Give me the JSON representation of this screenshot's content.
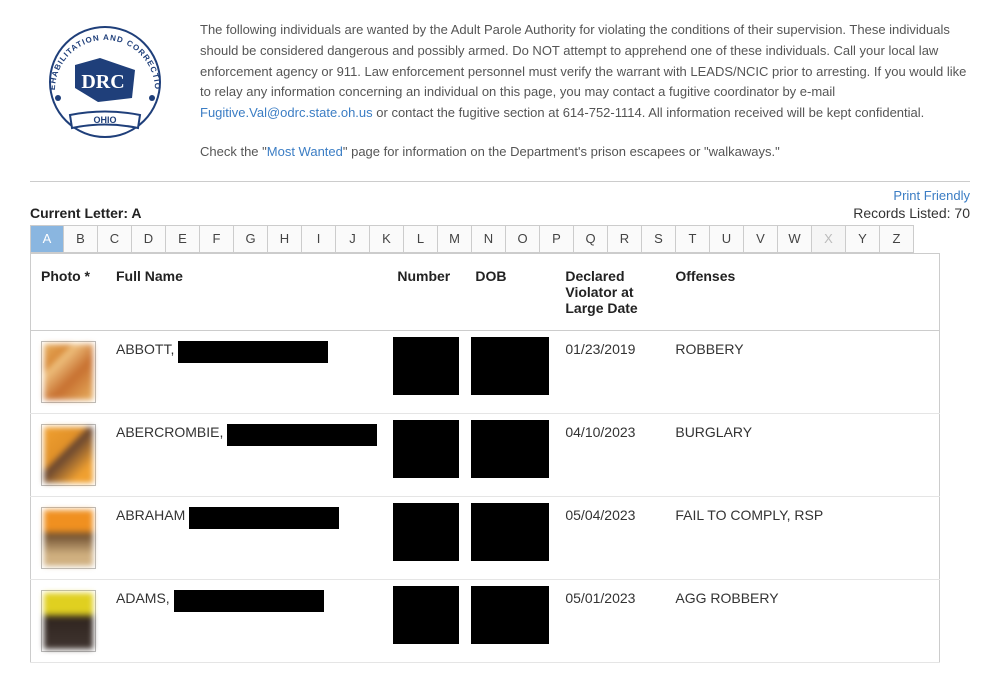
{
  "intro": {
    "para1_a": "The following individuals are wanted by the Adult Parole Authority for violating the conditions of their supervision.  These individuals should be considered dangerous and possibly armed.  Do NOT attempt to apprehend one of these individuals.  Call your local law enforcement agency or 911.  Law enforcement personnel must verify the warrant with LEADS/NCIC prior to arresting.  If you would like to relay any information concerning an individual on this page, you may contact a fugitive coordinator by e-mail ",
    "email_link": "Fugitive.Val@odrc.state.oh.us",
    "para1_b": " or contact the fugitive section at 614-752-1114.  All information received will be kept confidential.",
    "check_a": "Check the \"",
    "most_wanted": "Most Wanted",
    "check_b": "\" page for information on the Department's prison escapees or \"walkaways.\""
  },
  "toolbar": {
    "print_friendly": "Print Friendly"
  },
  "status": {
    "current_letter_label": "Current Letter: ",
    "current_letter": "A",
    "records_label": "Records Listed: ",
    "records_count": "70"
  },
  "alphabet": {
    "letters": [
      "A",
      "B",
      "C",
      "D",
      "E",
      "F",
      "G",
      "H",
      "I",
      "J",
      "K",
      "L",
      "M",
      "N",
      "O",
      "P",
      "Q",
      "R",
      "S",
      "T",
      "U",
      "V",
      "W",
      "X",
      "Y",
      "Z"
    ],
    "active": "A",
    "disabled": [
      "X"
    ]
  },
  "table": {
    "headers": {
      "photo": "Photo *",
      "name": "Full Name",
      "number": "Number",
      "dob": "DOB",
      "date": "Declared Violator at Large Date",
      "offenses": "Offenses"
    },
    "rows": [
      {
        "surname": "ABBOTT,",
        "date": "01/23/2019",
        "offenses": "ROBBERY"
      },
      {
        "surname": "ABERCROMBIE,",
        "date": "04/10/2023",
        "offenses": "BURGLARY"
      },
      {
        "surname": "ABRAHAM",
        "date": "05/04/2023",
        "offenses": "FAIL TO COMPLY, RSP"
      },
      {
        "surname": "ADAMS,",
        "date": "05/01/2023",
        "offenses": "AGG ROBBERY"
      }
    ]
  },
  "logo": {
    "top_text": "REHABILITATION AND CORRECTION",
    "center": "DRC",
    "bottom": "OHIO"
  }
}
